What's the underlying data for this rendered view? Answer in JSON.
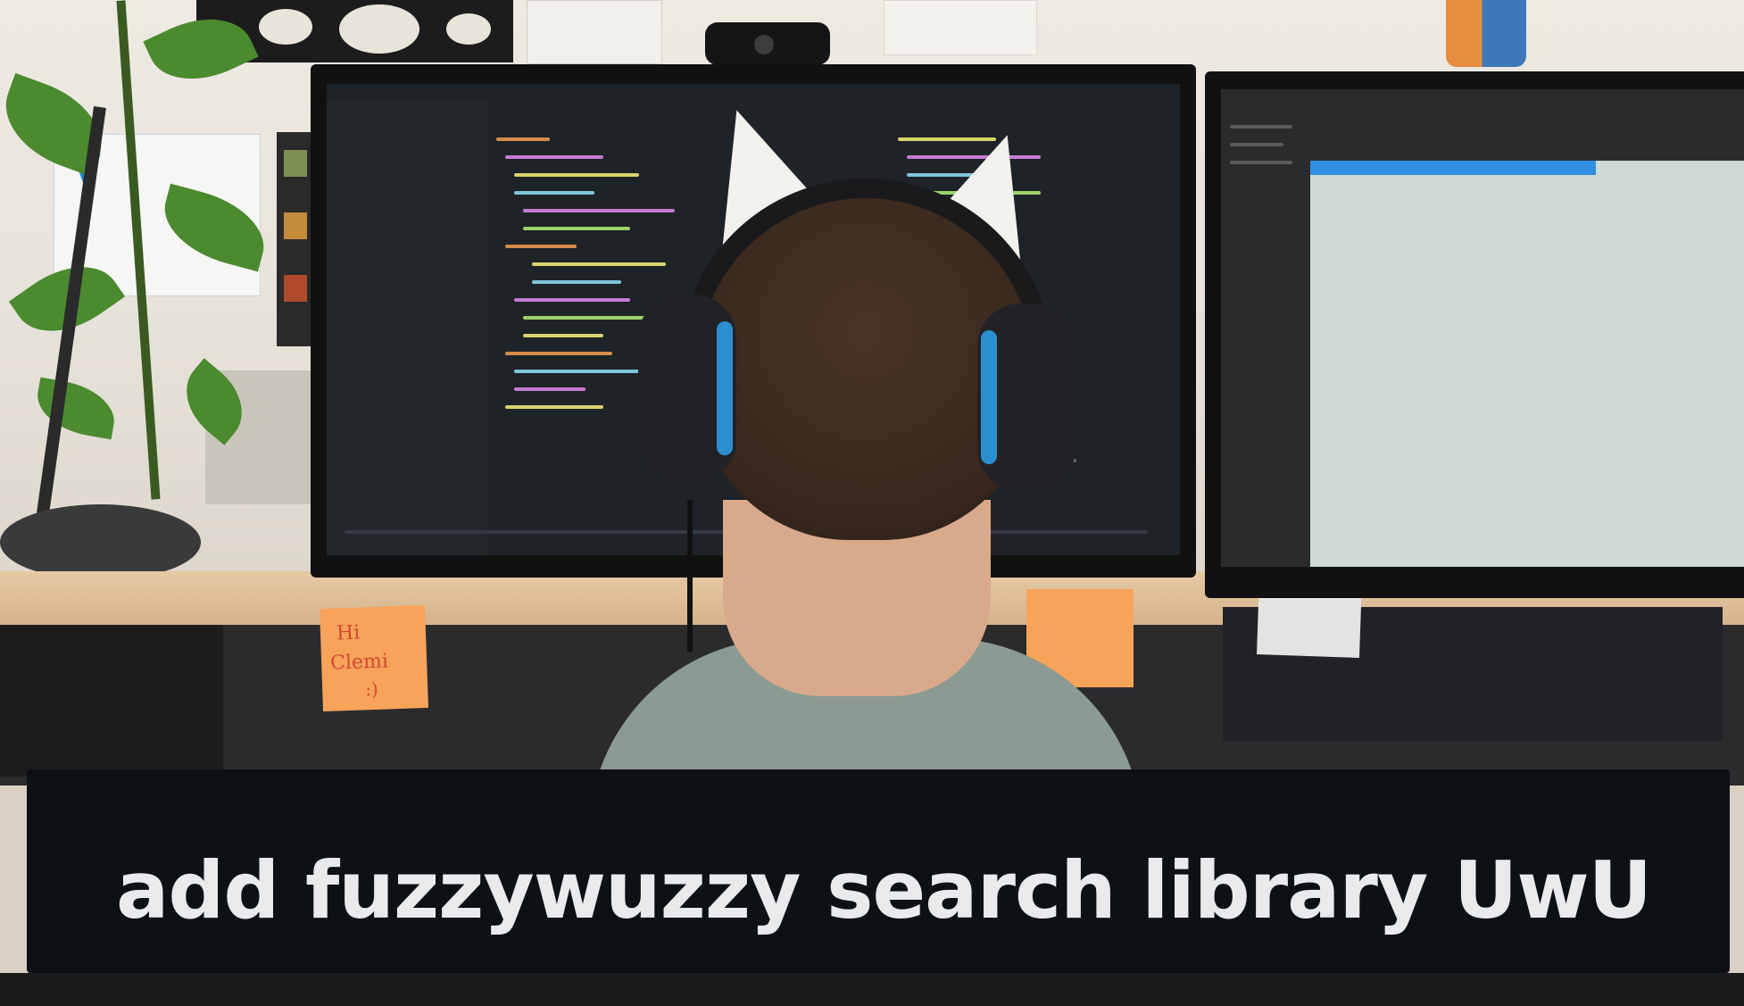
{
  "image": {
    "kind": "photo-meme",
    "colors": {
      "caption_background": "#0d1014",
      "caption_text": "#e9eaec",
      "sticky_note": "#f7a35a",
      "headphone_accent": "#2b8fcf",
      "hoodie": "#8b9a92"
    },
    "caption": "add fuzzywuzzy search library UwU",
    "sticky_note_text": "Hi Clemi :)"
  }
}
